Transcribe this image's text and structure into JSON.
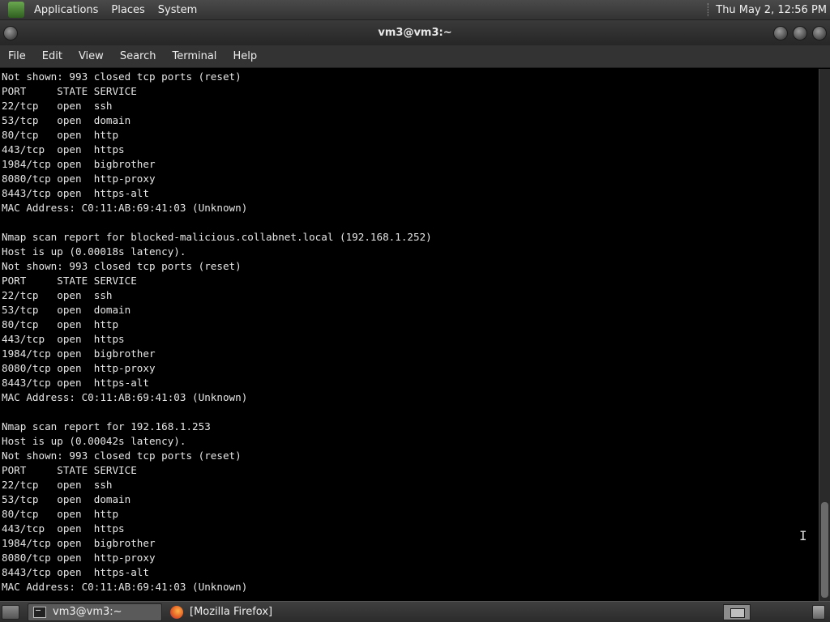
{
  "top_panel": {
    "menus": [
      "Applications",
      "Places",
      "System"
    ],
    "clock": "Thu May  2, 12:56 PM"
  },
  "window": {
    "title": "vm3@vm3:~"
  },
  "menubar": {
    "items": [
      "File",
      "Edit",
      "View",
      "Search",
      "Terminal",
      "Help"
    ]
  },
  "terminal": {
    "lines": [
      "Not shown: 993 closed tcp ports (reset)",
      "PORT     STATE SERVICE",
      "22/tcp   open  ssh",
      "53/tcp   open  domain",
      "80/tcp   open  http",
      "443/tcp  open  https",
      "1984/tcp open  bigbrother",
      "8080/tcp open  http-proxy",
      "8443/tcp open  https-alt",
      "MAC Address: C0:11:AB:69:41:03 (Unknown)",
      "",
      "Nmap scan report for blocked-malicious.collabnet.local (192.168.1.252)",
      "Host is up (0.00018s latency).",
      "Not shown: 993 closed tcp ports (reset)",
      "PORT     STATE SERVICE",
      "22/tcp   open  ssh",
      "53/tcp   open  domain",
      "80/tcp   open  http",
      "443/tcp  open  https",
      "1984/tcp open  bigbrother",
      "8080/tcp open  http-proxy",
      "8443/tcp open  https-alt",
      "MAC Address: C0:11:AB:69:41:03 (Unknown)",
      "",
      "Nmap scan report for 192.168.1.253",
      "Host is up (0.00042s latency).",
      "Not shown: 993 closed tcp ports (reset)",
      "PORT     STATE SERVICE",
      "22/tcp   open  ssh",
      "53/tcp   open  domain",
      "80/tcp   open  http",
      "443/tcp  open  https",
      "1984/tcp open  bigbrother",
      "8080/tcp open  http-proxy",
      "8443/tcp open  https-alt",
      "MAC Address: C0:11:AB:69:41:03 (Unknown)"
    ]
  },
  "taskbar": {
    "tasks": [
      {
        "label": "vm3@vm3:~",
        "icon": "terminal-icon",
        "active": true
      },
      {
        "label": "[Mozilla Firefox]",
        "icon": "firefox-icon",
        "active": false
      }
    ]
  },
  "colors": {
    "terminal_bg": "#000000",
    "terminal_fg": "#e6e6e6",
    "panel_bg": "#333333"
  }
}
